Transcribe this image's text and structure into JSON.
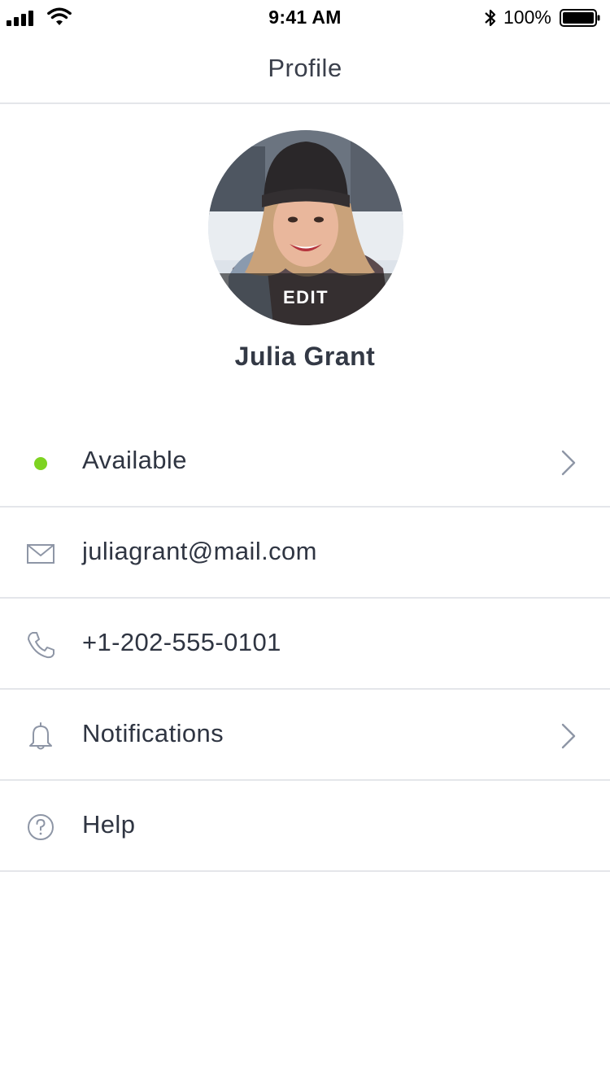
{
  "status_bar": {
    "time": "9:41 AM",
    "battery_percent": "100%",
    "signal_icon": "cellular-signal-icon",
    "wifi_icon": "wifi-icon",
    "bluetooth_icon": "bluetooth-icon",
    "battery_icon": "battery-icon",
    "battery_level": 1.0
  },
  "nav": {
    "title": "Profile"
  },
  "profile": {
    "avatar_edit_label": "EDIT",
    "name": "Julia Grant"
  },
  "list": {
    "items": [
      {
        "label": "Available",
        "icon": "status-dot",
        "has_chevron": true
      },
      {
        "label": "juliagrant@mail.com",
        "icon": "envelope-icon",
        "has_chevron": false
      },
      {
        "label": "+1-202-555-0101",
        "icon": "phone-icon",
        "has_chevron": false
      },
      {
        "label": "Notifications",
        "icon": "bell-icon",
        "has_chevron": true
      },
      {
        "label": "Help",
        "icon": "help-circle-icon",
        "has_chevron": false
      }
    ]
  },
  "colors": {
    "status_available": "#7ed321",
    "icon_gray": "#8e96a6",
    "divider": "#e4e6ea",
    "text": "#2f3542"
  }
}
